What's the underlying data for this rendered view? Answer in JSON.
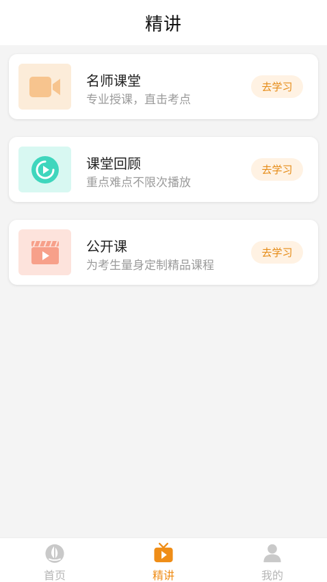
{
  "header": {
    "title": "精讲"
  },
  "courses": [
    {
      "title": "名师课堂",
      "subtitle": "专业授课，直击考点",
      "button": "去学习",
      "icon": "video-camera-icon"
    },
    {
      "title": "课堂回顾",
      "subtitle": "重点难点不限次播放",
      "button": "去学习",
      "icon": "replay-icon"
    },
    {
      "title": "公开课",
      "subtitle": "为考生量身定制精品课程",
      "button": "去学习",
      "icon": "clapperboard-icon"
    }
  ],
  "tabbar": {
    "items": [
      {
        "label": "首页",
        "icon": "sailboat-icon"
      },
      {
        "label": "精讲",
        "icon": "tv-play-icon",
        "active": true
      },
      {
        "label": "我的",
        "icon": "user-icon"
      }
    ]
  },
  "colors": {
    "accent": "#ef8d17",
    "button_bg": "#fff2e3",
    "button_text": "#e58a14",
    "inactive": "#b5b5b5"
  }
}
